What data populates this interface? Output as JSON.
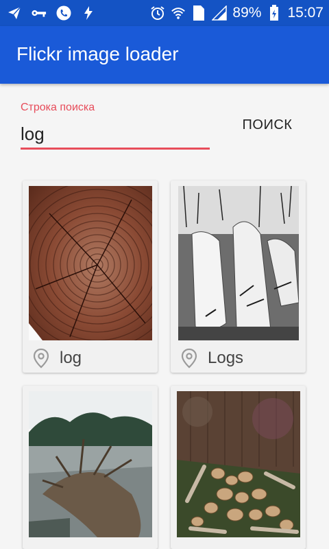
{
  "status_bar": {
    "battery": "89%",
    "time": "15:07",
    "sim": "1"
  },
  "app_bar": {
    "title": "Flickr image loader"
  },
  "search": {
    "label": "Строка поиска",
    "value": "log",
    "button_label": "ПОИСК"
  },
  "results": [
    {
      "caption": "log"
    },
    {
      "caption": "Logs"
    },
    {
      "caption": ""
    },
    {
      "caption": ""
    }
  ],
  "colors": {
    "app_bar": "#1a5ad8",
    "status_bar": "#1453c4",
    "accent": "#e74c5a"
  },
  "icons": [
    "telegram-icon",
    "key-icon",
    "phone-icon",
    "bolt-icon",
    "alarm-icon",
    "wifi-icon",
    "signal-icon",
    "battery-icon",
    "location-pin-icon"
  ]
}
